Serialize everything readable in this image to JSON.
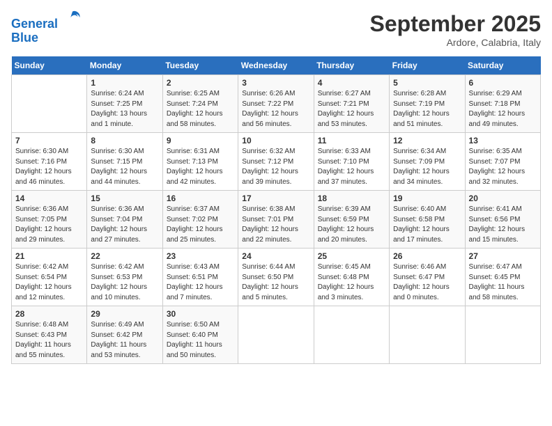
{
  "logo": {
    "line1": "General",
    "line2": "Blue"
  },
  "header": {
    "month": "September 2025",
    "location": "Ardore, Calabria, Italy"
  },
  "weekdays": [
    "Sunday",
    "Monday",
    "Tuesday",
    "Wednesday",
    "Thursday",
    "Friday",
    "Saturday"
  ],
  "weeks": [
    [
      {
        "day": "",
        "info": ""
      },
      {
        "day": "1",
        "info": "Sunrise: 6:24 AM\nSunset: 7:25 PM\nDaylight: 13 hours\nand 1 minute."
      },
      {
        "day": "2",
        "info": "Sunrise: 6:25 AM\nSunset: 7:24 PM\nDaylight: 12 hours\nand 58 minutes."
      },
      {
        "day": "3",
        "info": "Sunrise: 6:26 AM\nSunset: 7:22 PM\nDaylight: 12 hours\nand 56 minutes."
      },
      {
        "day": "4",
        "info": "Sunrise: 6:27 AM\nSunset: 7:21 PM\nDaylight: 12 hours\nand 53 minutes."
      },
      {
        "day": "5",
        "info": "Sunrise: 6:28 AM\nSunset: 7:19 PM\nDaylight: 12 hours\nand 51 minutes."
      },
      {
        "day": "6",
        "info": "Sunrise: 6:29 AM\nSunset: 7:18 PM\nDaylight: 12 hours\nand 49 minutes."
      }
    ],
    [
      {
        "day": "7",
        "info": "Sunrise: 6:30 AM\nSunset: 7:16 PM\nDaylight: 12 hours\nand 46 minutes."
      },
      {
        "day": "8",
        "info": "Sunrise: 6:30 AM\nSunset: 7:15 PM\nDaylight: 12 hours\nand 44 minutes."
      },
      {
        "day": "9",
        "info": "Sunrise: 6:31 AM\nSunset: 7:13 PM\nDaylight: 12 hours\nand 42 minutes."
      },
      {
        "day": "10",
        "info": "Sunrise: 6:32 AM\nSunset: 7:12 PM\nDaylight: 12 hours\nand 39 minutes."
      },
      {
        "day": "11",
        "info": "Sunrise: 6:33 AM\nSunset: 7:10 PM\nDaylight: 12 hours\nand 37 minutes."
      },
      {
        "day": "12",
        "info": "Sunrise: 6:34 AM\nSunset: 7:09 PM\nDaylight: 12 hours\nand 34 minutes."
      },
      {
        "day": "13",
        "info": "Sunrise: 6:35 AM\nSunset: 7:07 PM\nDaylight: 12 hours\nand 32 minutes."
      }
    ],
    [
      {
        "day": "14",
        "info": "Sunrise: 6:36 AM\nSunset: 7:05 PM\nDaylight: 12 hours\nand 29 minutes."
      },
      {
        "day": "15",
        "info": "Sunrise: 6:36 AM\nSunset: 7:04 PM\nDaylight: 12 hours\nand 27 minutes."
      },
      {
        "day": "16",
        "info": "Sunrise: 6:37 AM\nSunset: 7:02 PM\nDaylight: 12 hours\nand 25 minutes."
      },
      {
        "day": "17",
        "info": "Sunrise: 6:38 AM\nSunset: 7:01 PM\nDaylight: 12 hours\nand 22 minutes."
      },
      {
        "day": "18",
        "info": "Sunrise: 6:39 AM\nSunset: 6:59 PM\nDaylight: 12 hours\nand 20 minutes."
      },
      {
        "day": "19",
        "info": "Sunrise: 6:40 AM\nSunset: 6:58 PM\nDaylight: 12 hours\nand 17 minutes."
      },
      {
        "day": "20",
        "info": "Sunrise: 6:41 AM\nSunset: 6:56 PM\nDaylight: 12 hours\nand 15 minutes."
      }
    ],
    [
      {
        "day": "21",
        "info": "Sunrise: 6:42 AM\nSunset: 6:54 PM\nDaylight: 12 hours\nand 12 minutes."
      },
      {
        "day": "22",
        "info": "Sunrise: 6:42 AM\nSunset: 6:53 PM\nDaylight: 12 hours\nand 10 minutes."
      },
      {
        "day": "23",
        "info": "Sunrise: 6:43 AM\nSunset: 6:51 PM\nDaylight: 12 hours\nand 7 minutes."
      },
      {
        "day": "24",
        "info": "Sunrise: 6:44 AM\nSunset: 6:50 PM\nDaylight: 12 hours\nand 5 minutes."
      },
      {
        "day": "25",
        "info": "Sunrise: 6:45 AM\nSunset: 6:48 PM\nDaylight: 12 hours\nand 3 minutes."
      },
      {
        "day": "26",
        "info": "Sunrise: 6:46 AM\nSunset: 6:47 PM\nDaylight: 12 hours\nand 0 minutes."
      },
      {
        "day": "27",
        "info": "Sunrise: 6:47 AM\nSunset: 6:45 PM\nDaylight: 11 hours\nand 58 minutes."
      }
    ],
    [
      {
        "day": "28",
        "info": "Sunrise: 6:48 AM\nSunset: 6:43 PM\nDaylight: 11 hours\nand 55 minutes."
      },
      {
        "day": "29",
        "info": "Sunrise: 6:49 AM\nSunset: 6:42 PM\nDaylight: 11 hours\nand 53 minutes."
      },
      {
        "day": "30",
        "info": "Sunrise: 6:50 AM\nSunset: 6:40 PM\nDaylight: 11 hours\nand 50 minutes."
      },
      {
        "day": "",
        "info": ""
      },
      {
        "day": "",
        "info": ""
      },
      {
        "day": "",
        "info": ""
      },
      {
        "day": "",
        "info": ""
      }
    ]
  ]
}
